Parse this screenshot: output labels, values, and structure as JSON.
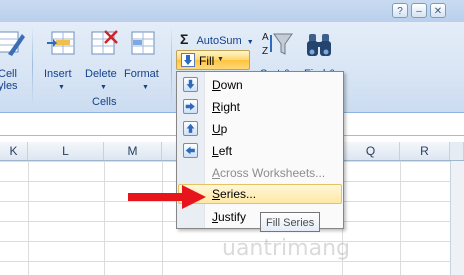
{
  "window": {
    "controls": [
      "?",
      "–",
      "✕"
    ]
  },
  "cells_group": {
    "label": "Cells",
    "buttons": [
      {
        "label": "Insert"
      },
      {
        "label": "Delete"
      },
      {
        "label": "Format"
      }
    ],
    "partial_left_label_1": "Cell",
    "partial_left_label_2": "yles"
  },
  "editing_group": {
    "autosum_label": "AutoSum",
    "fill_label": "Fill",
    "sort_label": "Sort &",
    "find_label": "Find &"
  },
  "sheet": {
    "columns": [
      "K",
      "L",
      "M",
      "Q",
      "R"
    ]
  },
  "fill_menu": {
    "items": [
      {
        "label": "Down",
        "accel": "D",
        "rest": "own",
        "disabled": false
      },
      {
        "label": "Right",
        "accel": "R",
        "rest": "ight",
        "disabled": false
      },
      {
        "label": "Up",
        "accel": "U",
        "rest": "p",
        "disabled": false
      },
      {
        "label": "Left",
        "accel": "L",
        "rest": "eft",
        "disabled": false
      },
      {
        "label": "Across Worksheets...",
        "accel": "A",
        "rest": "cross Worksheets...",
        "disabled": true
      },
      {
        "label": "Series...",
        "accel": "S",
        "rest": "eries...",
        "disabled": false,
        "highlighted": true
      },
      {
        "label": "Justify",
        "accel": "J",
        "rest": "ustify",
        "disabled": false
      }
    ]
  },
  "tooltip": "Fill Series",
  "watermark": "uantrimang",
  "colors": {
    "accent_highlight": "#ffe8a6",
    "arrow": "#e8141b"
  }
}
